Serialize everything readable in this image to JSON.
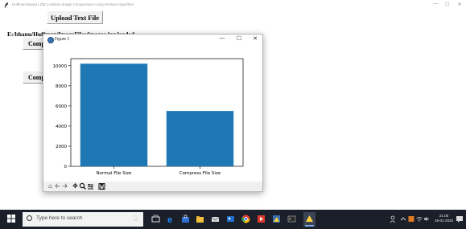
{
  "app": {
    "title": "Huffman Based LZW Lossless Image Compression Using Retinex Algorithm",
    "upload_label": "Upload Text File",
    "loaded_message": "E:/bhanu/Huffman/ImageFiles/images.jpg loaded",
    "compress_btn_1_label": "Compress",
    "compress_btn_2_label": "Compress",
    "window_controls": {
      "minimize": "—",
      "maximize": "☐",
      "close": "✕"
    }
  },
  "figure": {
    "title": "Figure 1",
    "controls": {
      "minimize": "—",
      "maximize": "☐",
      "close": "✕"
    },
    "toolbar_icons": [
      "home-icon",
      "back-arrow-icon",
      "forward-arrow-icon",
      "pan-icon",
      "zoom-icon",
      "configure-subplots-icon",
      "save-icon"
    ]
  },
  "chart_data": {
    "type": "bar",
    "categories": [
      "Normal File Size",
      "Compress File Size"
    ],
    "values": [
      10200,
      5500
    ],
    "ylim": [
      0,
      10700
    ],
    "yticks": [
      0,
      2000,
      4000,
      6000,
      8000,
      10000
    ],
    "bar_color": "#1f77b4",
    "grid": false
  },
  "taskbar": {
    "search_placeholder": "Type here to search",
    "time": "21:05",
    "date": "16-01-2020",
    "colors": {
      "background": "#1b1f2a",
      "accent": "#0078d7"
    }
  }
}
